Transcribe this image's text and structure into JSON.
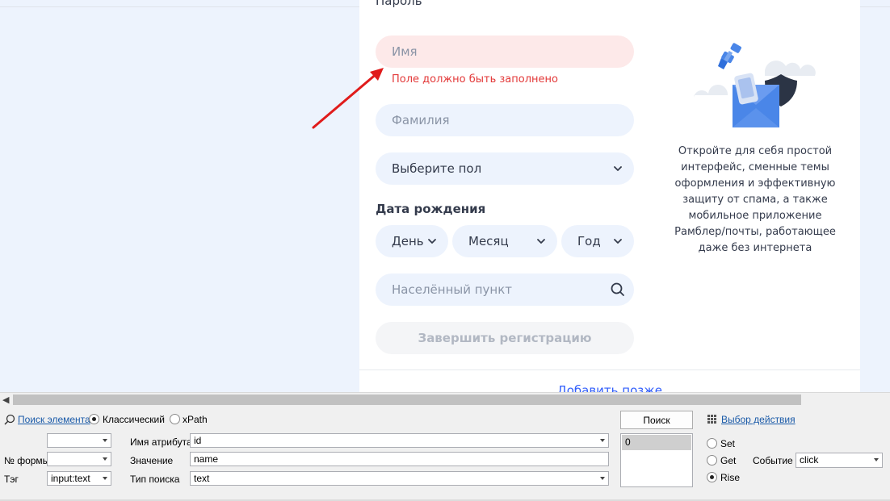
{
  "form": {
    "cut_label": "Пароль",
    "first_name_placeholder": "Имя",
    "first_name_error": "Поле должно быть заполнено",
    "last_name_placeholder": "Фамилия",
    "gender_select": "Выберите пол",
    "birthdate_title": "Дата рождения",
    "day_select": "День",
    "month_select": "Месяц",
    "year_select": "Год",
    "city_placeholder": "Населённый пункт",
    "submit_label": "Завершить регистрацию",
    "add_later_link": "Добавить позже"
  },
  "promo": {
    "text": "Откройте для себя простой интерфейс, сменные темы оформления и эффективную защиту от спама, а также мобильное приложение Рамблер/почты, работающее даже без интернета"
  },
  "panel": {
    "search_element_link": "Поиск элемента",
    "mode_classic": "Классический",
    "mode_xpath": "xPath",
    "form_number_label": "№ формы",
    "tag_label": "Тэг",
    "tag_value": "input:text",
    "attr_name_label": "Имя атрибута",
    "attr_name_value": "id",
    "value_label": "Значение",
    "value_value": "name",
    "search_type_label": "Тип поиска",
    "search_type_value": "text",
    "search_button": "Поиск",
    "results": [
      "0"
    ],
    "action_choice_link": "Выбор действия",
    "action_set": "Set",
    "action_get": "Get",
    "action_rise": "Rise",
    "event_label": "Событие",
    "event_value": "click"
  },
  "colors": {
    "accent_blue": "#315efb",
    "error_red": "#e33a3a",
    "field_bg": "#edf3fd",
    "error_field_bg": "#fde9e9"
  }
}
